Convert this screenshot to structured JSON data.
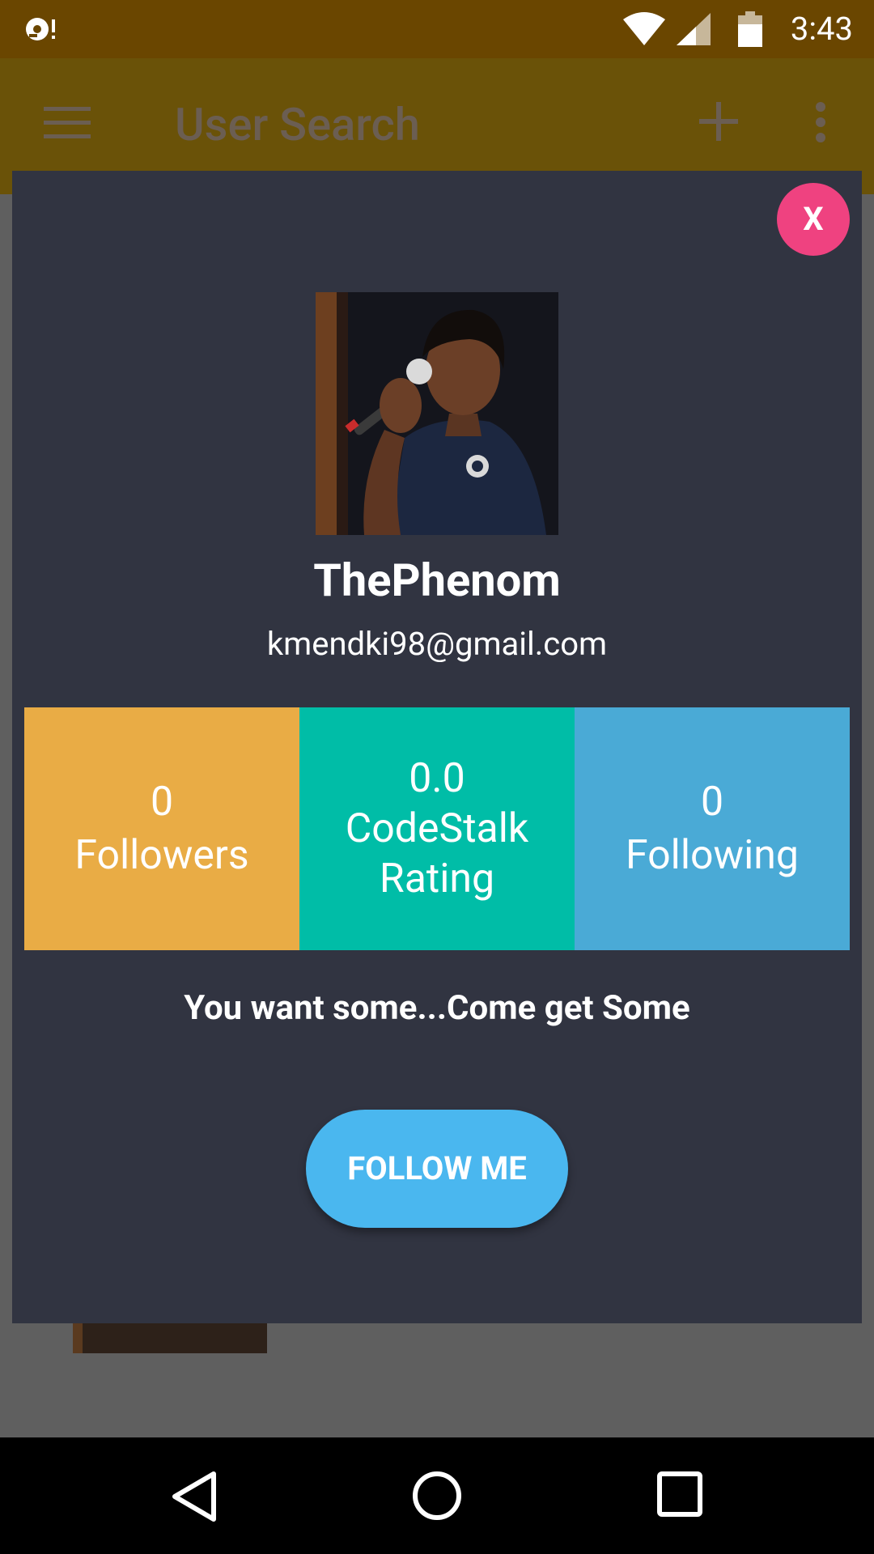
{
  "status_bar": {
    "time": "3:43",
    "icons": [
      "notification-icon",
      "wifi-icon",
      "signal-icon",
      "battery-icon"
    ]
  },
  "app_bar": {
    "title": "User Search",
    "icons": [
      "menu-icon",
      "add-icon",
      "more-vert-icon"
    ]
  },
  "dialog": {
    "close_label": "X",
    "username": "ThePhenom",
    "email": "kmendki98@gmail.com",
    "stats": {
      "followers": {
        "value": "0",
        "label": "Followers"
      },
      "rating": {
        "value": "0.0",
        "label_line1": "CodeStalk",
        "label_line2": "Rating"
      },
      "following": {
        "value": "0",
        "label": "Following"
      }
    },
    "quote": "You want some...Come get Some",
    "follow_button_label": "FOLLOW ME"
  },
  "colors": {
    "status_bar": "#6a4600",
    "app_bar": "#6a5208",
    "dialog_bg": "#313441",
    "close_button": "#ef4280",
    "followers_tile": "#e9ac45",
    "rating_tile": "#00bda7",
    "following_tile": "#4aaad6",
    "follow_button": "#4ab7ef"
  },
  "nav_bar": {
    "icons": [
      "back-icon",
      "home-icon",
      "recents-icon"
    ]
  }
}
